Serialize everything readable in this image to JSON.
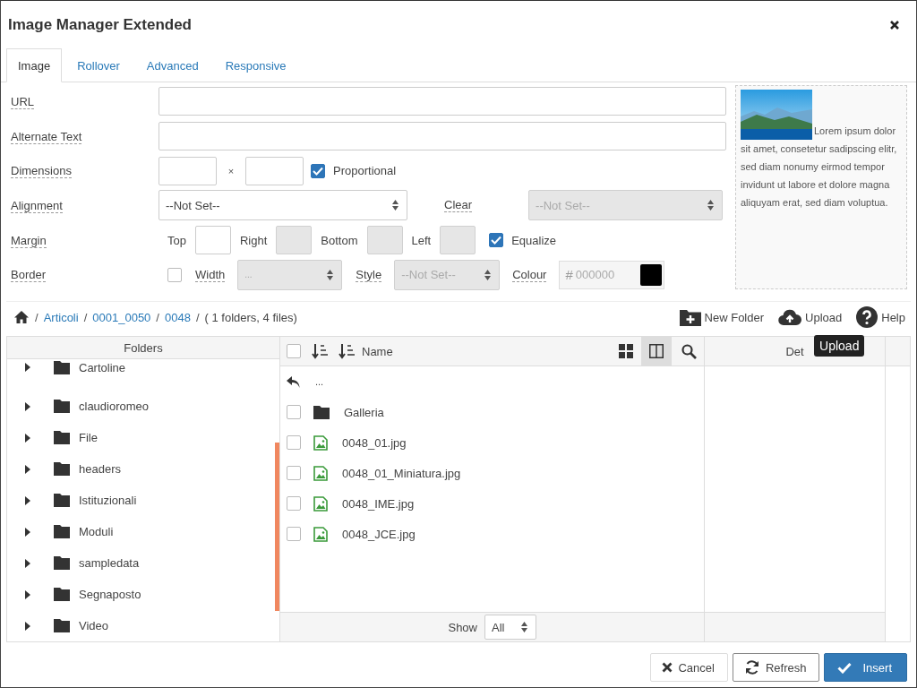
{
  "dialog": {
    "title": "Image Manager Extended"
  },
  "tabs": [
    {
      "label": "Image",
      "selected": true
    },
    {
      "label": "Rollover",
      "selected": false
    },
    {
      "label": "Advanced",
      "selected": false
    },
    {
      "label": "Responsive",
      "selected": false
    }
  ],
  "form": {
    "url": {
      "label": "URL"
    },
    "alt": {
      "label": "Alternate Text"
    },
    "dimensions": {
      "label": "Dimensions",
      "separator": "×",
      "proportional": {
        "label": "Proportional",
        "checked": true
      }
    },
    "alignment": {
      "label": "Alignment",
      "value": "--Not Set--",
      "disabled": false
    },
    "clear": {
      "label": "Clear",
      "value": "--Not Set--",
      "disabled": true
    },
    "margin": {
      "label": "Margin",
      "sides": [
        {
          "label": "Top",
          "disabled": false
        },
        {
          "label": "Right",
          "disabled": true
        },
        {
          "label": "Bottom",
          "disabled": true
        },
        {
          "label": "Left",
          "disabled": true
        }
      ],
      "equalize": {
        "label": "Equalize",
        "checked": true
      }
    },
    "border": {
      "label": "Border",
      "checked": false,
      "width": {
        "label": "Width",
        "value": "...",
        "disabled": true
      },
      "style": {
        "label": "Style",
        "value": "--Not Set--",
        "disabled": true
      },
      "colour": {
        "label": "Colour",
        "prefix": "#",
        "placeholder": "000000",
        "color": "#000000"
      }
    }
  },
  "preview": {
    "text": "Lorem ipsum dolor sit amet, consetetur sadipscing elitr, sed diam nonumy eirmod tempor invidunt ut labore et dolore magna aliquyam erat, sed diam voluptua."
  },
  "breadcrumb": {
    "crumbs": [
      "Articoli",
      "0001_0050",
      "0048"
    ],
    "separator": "/",
    "summary": "( 1 folders, 4 files)"
  },
  "actions": [
    {
      "kind": "new-folder",
      "label": "New Folder"
    },
    {
      "kind": "upload",
      "label": "Upload"
    },
    {
      "kind": "help",
      "label": "Help"
    }
  ],
  "tooltip": {
    "text": "Upload"
  },
  "folders": {
    "title": "Folders",
    "items": [
      {
        "name": "Cartoline",
        "expanded": false
      },
      {
        "name": "claudioromeo",
        "expanded": false
      },
      {
        "name": "File",
        "expanded": false
      },
      {
        "name": "headers",
        "expanded": false
      },
      {
        "name": "Istituzionali",
        "expanded": false
      },
      {
        "name": "Moduli",
        "expanded": false
      },
      {
        "name": "sampledata",
        "expanded": false
      },
      {
        "name": "Segnaposto",
        "expanded": false
      },
      {
        "name": "Video",
        "expanded": false
      }
    ]
  },
  "files": {
    "header": "Name",
    "select_all": false,
    "views": [
      {
        "kind": "grid",
        "selected": false
      },
      {
        "kind": "columns",
        "selected": true
      }
    ],
    "up": "...",
    "items": [
      {
        "kind": "folder",
        "name": "Galleria",
        "checked": false
      },
      {
        "kind": "image",
        "name": "0048_01.jpg",
        "checked": false
      },
      {
        "kind": "image",
        "name": "0048_01_Miniatura.jpg",
        "checked": false
      },
      {
        "kind": "image",
        "name": "0048_IME.jpg",
        "checked": false
      },
      {
        "kind": "image",
        "name": "0048_JCE.jpg",
        "checked": false
      }
    ],
    "show": {
      "label": "Show",
      "value": "All"
    }
  },
  "details": {
    "title": "Det"
  },
  "buttons": [
    {
      "kind": "cancel",
      "label": "Cancel"
    },
    {
      "kind": "refresh",
      "label": "Refresh"
    },
    {
      "kind": "insert",
      "label": "Insert"
    }
  ]
}
